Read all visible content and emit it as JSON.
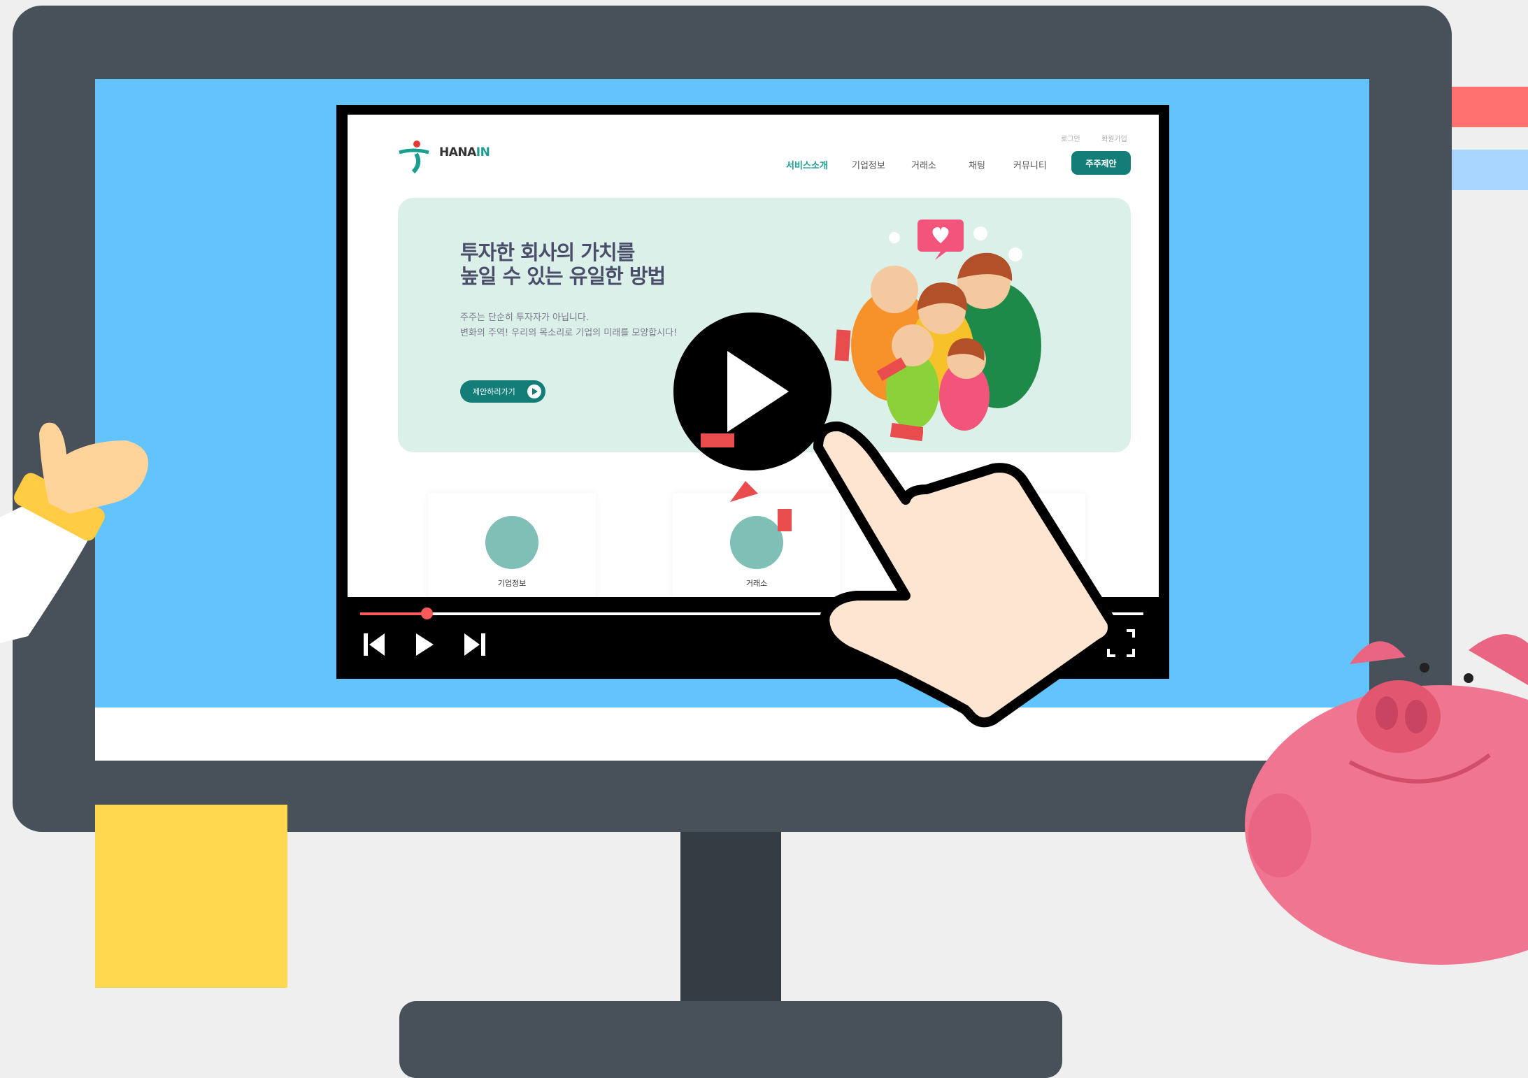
{
  "site": {
    "logo_text_a": "HANA",
    "logo_text_b": "IN",
    "util_links": [
      "로그인",
      "회원가입"
    ],
    "nav": [
      "서비스소개",
      "기업정보",
      "거래소",
      "채팅",
      "커뮤니티"
    ],
    "cta": "주주제안",
    "hero": {
      "title": "투자한 회사의 가치를\n높일 수 있는 유일한 방법",
      "desc": "주주는 단순히 투자자가 아닙니다.\n변화의 주역! 우리의 목소리로 기업의 미래를 모양합시다!",
      "button": "제안하러가기"
    },
    "cards": [
      "기업정보",
      "거래소"
    ]
  },
  "player": {
    "progress_fraction": 0.085,
    "controls": [
      "previous-icon",
      "play-icon",
      "next-icon",
      "fullscreen-icon"
    ]
  },
  "colors": {
    "accent": "#137e78",
    "screen": "#63c4fd",
    "monitor": "#485059",
    "progress": "#ff5a5a"
  }
}
